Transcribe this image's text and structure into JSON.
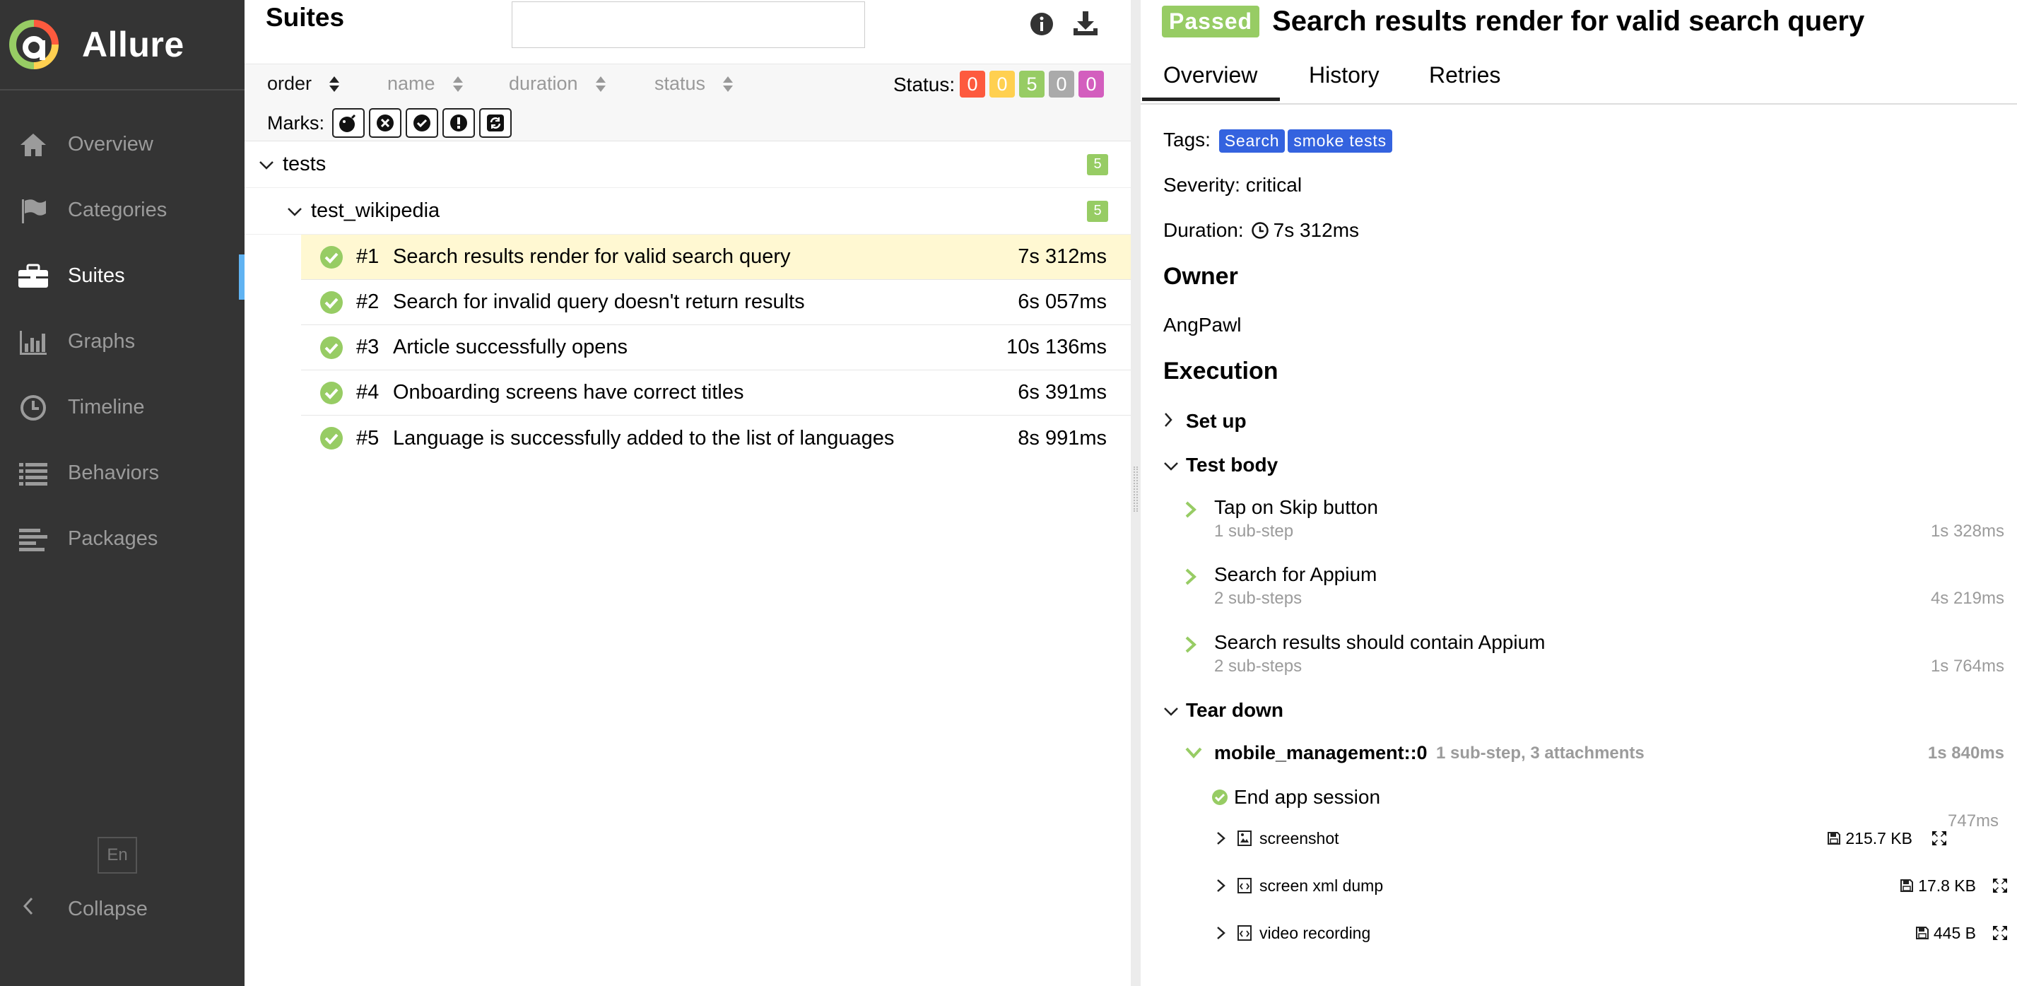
{
  "sidebar": {
    "brand": "Allure",
    "items": [
      {
        "label": "Overview",
        "icon": "home-icon"
      },
      {
        "label": "Categories",
        "icon": "flag-icon"
      },
      {
        "label": "Suites",
        "icon": "briefcase-icon",
        "active": true
      },
      {
        "label": "Graphs",
        "icon": "bar-chart-icon"
      },
      {
        "label": "Timeline",
        "icon": "clock-icon"
      },
      {
        "label": "Behaviors",
        "icon": "list-icon"
      },
      {
        "label": "Packages",
        "icon": "align-left-icon"
      }
    ],
    "language": "En",
    "collapse": "Collapse"
  },
  "suites": {
    "title": "Suites",
    "search_value": "",
    "sort": {
      "order": "order",
      "name": "name",
      "duration": "duration",
      "status": "status"
    },
    "status_label": "Status:",
    "counters": [
      {
        "value": "0",
        "color": "#fd5a3e"
      },
      {
        "value": "0",
        "color": "#ffd050"
      },
      {
        "value": "5",
        "color": "#97cc64"
      },
      {
        "value": "0",
        "color": "#aaaaaa"
      },
      {
        "value": "0",
        "color": "#d35ebe"
      }
    ],
    "marks_label": "Marks:",
    "groups": [
      {
        "name": "tests",
        "count": "5"
      },
      {
        "name": "test_wikipedia",
        "count": "5"
      }
    ],
    "tests": [
      {
        "num": "#1",
        "name": "Search results render for valid search query",
        "duration": "7s 312ms",
        "selected": true
      },
      {
        "num": "#2",
        "name": "Search for invalid query doesn't return results",
        "duration": "6s 057ms"
      },
      {
        "num": "#3",
        "name": "Article successfully opens",
        "duration": "10s 136ms"
      },
      {
        "num": "#4",
        "name": "Onboarding screens have correct titles",
        "duration": "6s 391ms"
      },
      {
        "num": "#5",
        "name": "Language is successfully added to the list of languages",
        "duration": "8s 991ms"
      }
    ]
  },
  "detail": {
    "status": "Passed",
    "title": "Search results render for valid search query",
    "tabs": [
      "Overview",
      "History",
      "Retries"
    ],
    "tags_label": "Tags:",
    "tags": [
      "Search",
      "smoke tests"
    ],
    "severity": "Severity: critical",
    "duration_label": "Duration:",
    "duration": "7s 312ms",
    "owner_heading": "Owner",
    "owner": "AngPawl",
    "execution_heading": "Execution",
    "setup": "Set up",
    "test_body": "Test body",
    "steps": [
      {
        "title": "Tap on Skip button",
        "sub": "1 sub-step",
        "duration": "1s 328ms"
      },
      {
        "title": "Search for Appium",
        "sub": "2 sub-steps",
        "duration": "4s 219ms"
      },
      {
        "title": "Search results should contain Appium",
        "sub": "2 sub-steps",
        "duration": "1s 764ms"
      }
    ],
    "teardown": "Tear down",
    "fixture": {
      "name": "mobile_management::0",
      "meta": "1 sub-step, 3 attachments",
      "duration": "1s 840ms"
    },
    "end_session": {
      "title": "End app session",
      "duration": "747ms"
    },
    "attachments": [
      {
        "name": "screenshot",
        "size": "215.7 KB"
      },
      {
        "name": "screen xml dump",
        "size": "17.8 KB"
      },
      {
        "name": "video recording",
        "size": "445 B"
      }
    ]
  }
}
